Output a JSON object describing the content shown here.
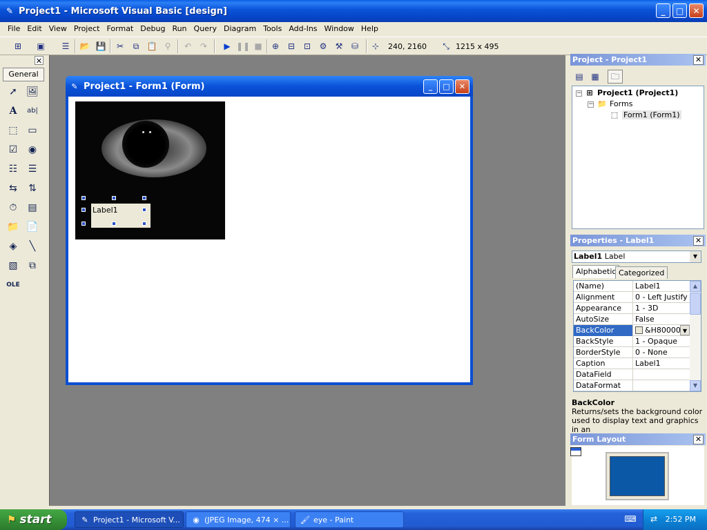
{
  "window": {
    "title": "Project1 - Microsoft Visual Basic [design]",
    "minimize": "_",
    "maximize": "□",
    "close": "✕"
  },
  "menu": [
    "File",
    "Edit",
    "View",
    "Project",
    "Format",
    "Debug",
    "Run",
    "Query",
    "Diagram",
    "Tools",
    "Add-Ins",
    "Window",
    "Help"
  ],
  "toolbar": {
    "position": "240, 2160",
    "size": "1215 x 495"
  },
  "toolbox": {
    "tab": "General",
    "close": "✕"
  },
  "form_window": {
    "title": "Project1 - Form1 (Form)",
    "minimize": "_",
    "maximize": "□",
    "close": "✕",
    "label_caption": "Label1"
  },
  "project_explorer": {
    "title": "Project - Project1",
    "close": "✕",
    "root": "Project1 (Project1)",
    "folder": "Forms",
    "form": "Form1 (Form1)",
    "collapse": "−"
  },
  "properties": {
    "title": "Properties - Label1",
    "close": "✕",
    "object_name": "Label1",
    "object_type": "Label",
    "tabs": [
      "Alphabetic",
      "Categorized"
    ],
    "rows": [
      {
        "name": "(Name)",
        "value": "Label1"
      },
      {
        "name": "Alignment",
        "value": "0 - Left Justify"
      },
      {
        "name": "Appearance",
        "value": "1 - 3D"
      },
      {
        "name": "AutoSize",
        "value": "False"
      },
      {
        "name": "BackColor",
        "value": "&H80000"
      },
      {
        "name": "BackStyle",
        "value": "1 - Opaque"
      },
      {
        "name": "BorderStyle",
        "value": "0 - None"
      },
      {
        "name": "Caption",
        "value": "Label1"
      },
      {
        "name": "DataField",
        "value": ""
      },
      {
        "name": "DataFormat",
        "value": ""
      }
    ],
    "selected_row": "BackColor",
    "description_title": "BackColor",
    "description_text": "Returns/sets the background color used to display text and graphics in an"
  },
  "form_layout": {
    "title": "Form Layout",
    "close": "✕"
  },
  "taskbar": {
    "start": "start",
    "buttons": [
      "Project1 - Microsoft V...",
      "(JPEG Image, 474 × ...",
      "eye - Paint"
    ],
    "clock": "2:52 PM"
  },
  "colors": {
    "xp_blue": "#0a52d8",
    "selection": "#316ac5",
    "mdi_background": "#808080",
    "start_green": "#379237",
    "face": "#ece9d8"
  },
  "icons": {
    "app": "vb-app-icon",
    "form": "form-icon",
    "project": "project-icon",
    "folder": "folder-icon"
  }
}
